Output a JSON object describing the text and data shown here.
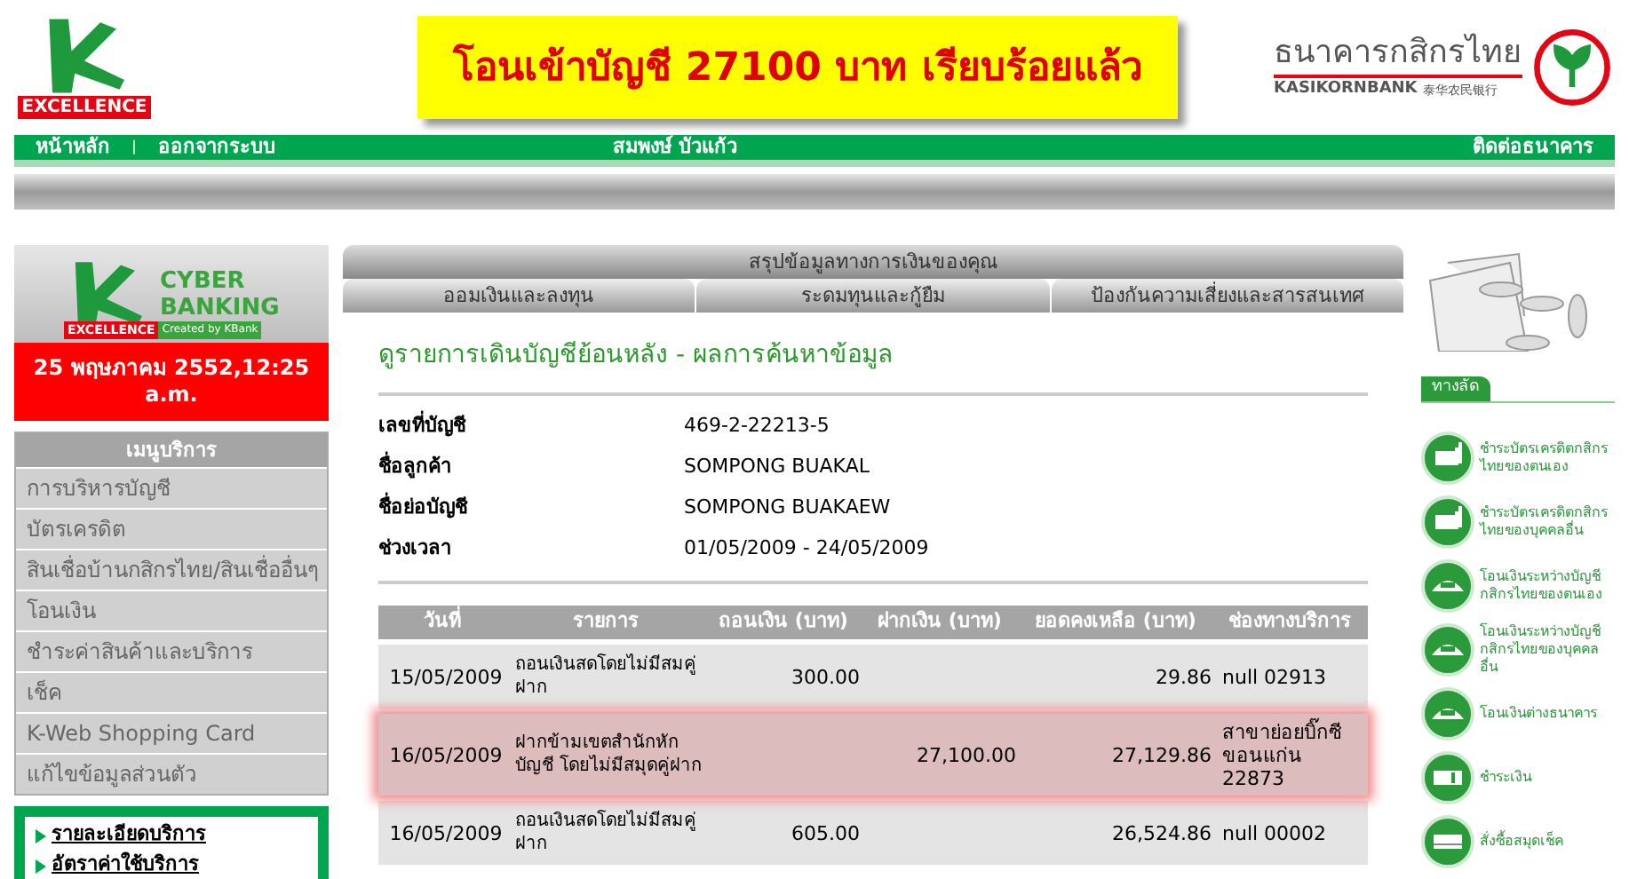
{
  "header": {
    "logo_text": "EXCELLENCE",
    "banner": "โอนเข้าบัญชี 27100 บาท เรียบร้อยแล้ว",
    "bank_name": "ธนาคารกสิกรไทย",
    "bank_name_en": "KASIKORNBANK",
    "bank_name_cn": "泰华农民银行"
  },
  "nav": {
    "left": [
      "หน้าหลัก",
      "ออกจากระบบ"
    ],
    "separator": "|",
    "user": "สมพงษ์ บัวแก้ว",
    "right": "ติดต่อธนาคาร"
  },
  "sidebar": {
    "logo": {
      "line1": "CYBER",
      "line2": "BANKING",
      "tag": "EXCELLENCE",
      "tag2": "Created by KBank"
    },
    "datetime": "25 พฤษภาคม 2552,12:25 a.m.",
    "menu_title": "เมนูบริการ",
    "menu": [
      "การบริหารบัญชี",
      "บัตรเครดิต",
      "สินเชื่อบ้านกสิกรไทย/สินเชื่ออื่นๆ",
      "โอนเงิน",
      "ชำระค่าสินค้าและบริการ",
      "เช็ค",
      "K-Web Shopping Card",
      "แก้ไขข้อมูลส่วนตัว"
    ],
    "links": [
      "รายละเอียดบริการ",
      "อัตราค่าใช้บริการ"
    ]
  },
  "tabs": {
    "top": "สรุปข้อมูลทางการเงินของคุณ",
    "items": [
      "ออมเงินและลงทุน",
      "ระดมทุนและกู้ยืม",
      "ป้องกันความเสี่ยงและสารสนเทศ"
    ]
  },
  "page_title": "ดูรายการเดินบัญชีย้อนหลัง - ผลการค้นหาข้อมูล",
  "details": [
    {
      "label": "เลขที่บัญชี",
      "value": "469-2-22213-5"
    },
    {
      "label": "ชื่อลูกค้า",
      "value": "SOMPONG BUAKAL"
    },
    {
      "label": "ชื่อย่อบัญชี",
      "value": "SOMPONG BUAKAEW"
    },
    {
      "label": "ช่วงเวลา",
      "value": "01/05/2009 - 24/05/2009"
    }
  ],
  "table": {
    "columns": [
      "วันที่",
      "รายการ",
      "ถอนเงิน (บาท)",
      "ฝากเงิน (บาท)",
      "ยอดคงเหลือ (บาท)",
      "ช่องทางบริการ"
    ],
    "rows": [
      {
        "highlighted": false,
        "cells": [
          "15/05/2009",
          "ถอนเงินสดโดยไม่มีสมคู่ฝาก",
          "300.00",
          "",
          "29.86",
          "null 02913"
        ]
      },
      {
        "highlighted": true,
        "cells": [
          "16/05/2009",
          "ฝากข้ามเขตสำนักหักบัญชี โดยไม่มีสมุดคู่ฝาก",
          "",
          "27,100.00",
          "27,129.86",
          "สาขาย่อยบิ๊กซี ขอนแก่น 22873"
        ]
      },
      {
        "highlighted": false,
        "cells": [
          "16/05/2009",
          "ถอนเงินสดโดยไม่มีสมคู่ฝาก",
          "605.00",
          "",
          "26,524.86",
          "null 00002"
        ]
      }
    ]
  },
  "shortcuts": {
    "title": "ทางลัด",
    "items": [
      {
        "kind": "card",
        "label": "ชำระบัตรเครดิตกสิกรไทยของตนเอง"
      },
      {
        "kind": "card",
        "label": "ชำระบัตรเครดิตกสิกรไทยของบุคคลอื่น"
      },
      {
        "kind": "transfer",
        "label": "โอนเงินระหว่างบัญชีกสิกรไทยของตนเอง"
      },
      {
        "kind": "transfer",
        "label": "โอนเงินระหว่างบัญชีกสิกรไทยของบุคคลอื่น"
      },
      {
        "kind": "transfer",
        "label": "โอนเงินต่างธนาคาร"
      },
      {
        "kind": "bill",
        "label": "ชำระเงิน"
      },
      {
        "kind": "checkbook",
        "label": "สั่งซื้อสมุดเช็ค"
      }
    ]
  }
}
